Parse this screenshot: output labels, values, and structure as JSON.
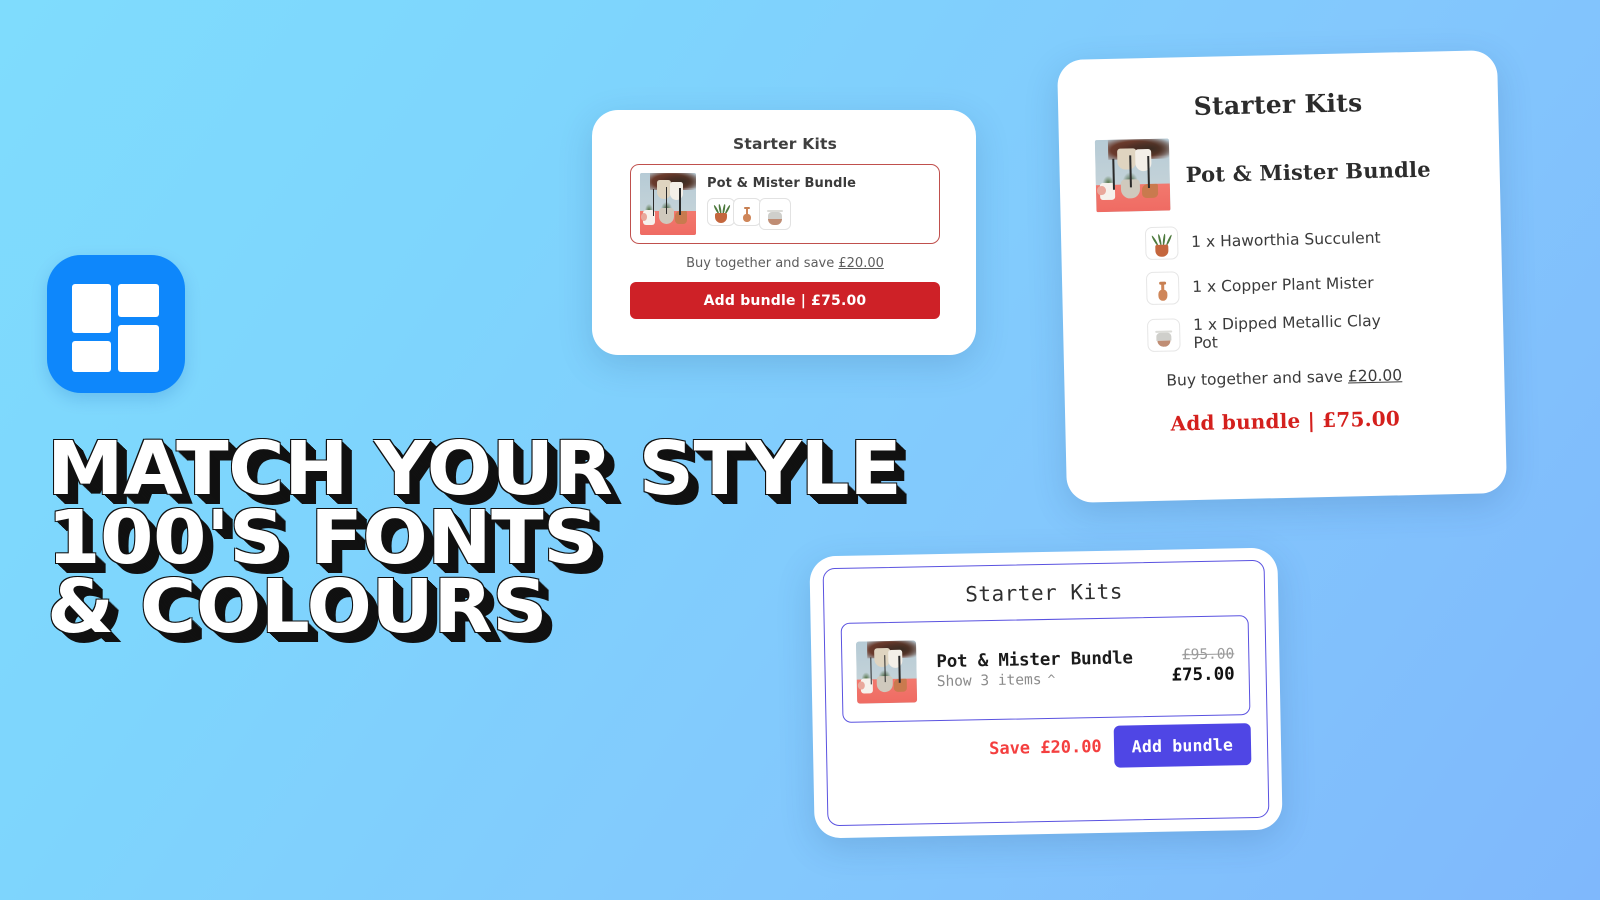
{
  "promo": {
    "logo_icon": "grid-tiles-app-icon",
    "headline_lines": [
      "MATCH YOUR STYLE",
      "100'S FONTS",
      "& COLOURS"
    ]
  },
  "colors": {
    "background_start": "#7fdcfd",
    "background_end": "#7fb8fc",
    "brand_blue": "#0e87fb",
    "card1_accent": "#ce2127",
    "card2_accent": "#d4201d",
    "card3_accent": "#4f46e5",
    "save_red": "#f43f3f"
  },
  "card1": {
    "title": "Starter Kits",
    "bundle_name": "Pot & Mister Bundle",
    "thumbnails": [
      "succulent-icon",
      "mister-icon",
      "clay-pot-icon"
    ],
    "save_label": "Buy together and save",
    "save_amount": "£20.00",
    "cta_label": "Add bundle | £75.00"
  },
  "card2": {
    "title": "Starter Kits",
    "bundle_name": "Pot & Mister Bundle",
    "items": [
      {
        "label": "1 x Haworthia Succulent",
        "icon": "succulent-icon"
      },
      {
        "label": "1 x Copper Plant Mister",
        "icon": "mister-icon"
      },
      {
        "label": "1 x Dipped Metallic Clay Pot",
        "icon": "clay-pot-icon"
      }
    ],
    "save_label": "Buy together and save",
    "save_amount": "£20.00",
    "cta_label": "Add bundle | £75.00"
  },
  "card3": {
    "title": "Starter Kits",
    "bundle_name": "Pot & Mister Bundle",
    "show_items_label": "Show 3 items",
    "chevron_icon": "chevron-up-icon",
    "old_price": "£95.00",
    "new_price": "£75.00",
    "save_label": "Save £20.00",
    "cta_label": "Add bundle"
  }
}
